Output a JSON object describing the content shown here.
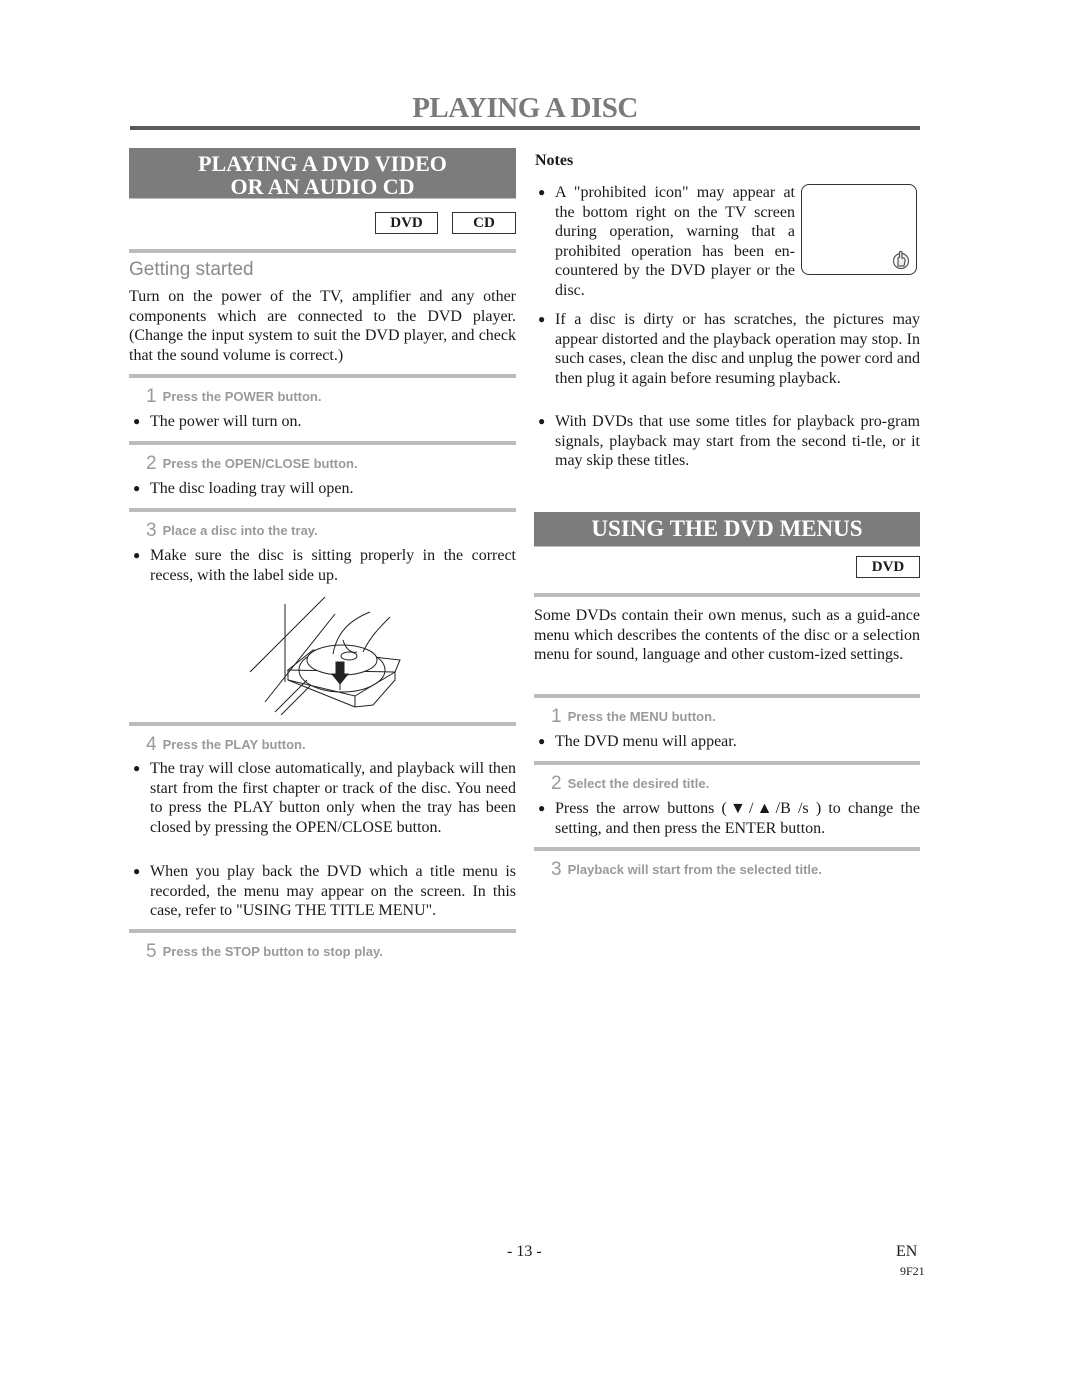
{
  "page": {
    "title": "PLAYING A DISC",
    "page_number": "- 13 -",
    "language": "EN",
    "model_code": "9F21"
  },
  "left_section": {
    "heading_line1": "PLAYING A DVD VIDEO",
    "heading_line2": "OR AN AUDIO CD",
    "badges": [
      "DVD",
      "CD"
    ],
    "subheading": "Getting started",
    "intro": "Turn on the power of the TV, amplifier and any other components which are connected to the DVD player. (Change the input system to suit the DVD player, and check that the sound volume is correct.)",
    "steps": [
      {
        "number": "1",
        "label": "Press the POWER button.",
        "bullets": [
          "The power will turn on."
        ]
      },
      {
        "number": "2",
        "label": "Press the OPEN/CLOSE button.",
        "bullets": [
          "The disc loading tray will open."
        ]
      },
      {
        "number": "3",
        "label": "Place a disc into the tray.",
        "bullets": [
          "Make sure the disc is sitting properly in the correct recess, with the label side up."
        ]
      },
      {
        "number": "4",
        "label": "Press the PLAY button.",
        "bullets": [
          "The tray will close automatically, and playback will then start from the first chapter or track of the disc. You need to press the PLAY button only when the tray has been closed by pressing the OPEN/CLOSE button.",
          "When you play back the DVD which a title menu is recorded, the menu may appear on the screen. In this case, refer to \"USING THE TITLE MENU\"."
        ]
      },
      {
        "number": "5",
        "label": "Press the STOP button to stop play.",
        "bullets": []
      }
    ],
    "illustration": "disc-tray-illustration"
  },
  "notes": {
    "label": "Notes",
    "items": [
      "A \"prohibited icon\" may appear at the bottom right on the TV screen during operation, warning that a prohibited operation has been en-countered by the DVD player or the disc.",
      "If a disc is dirty or has scratches, the pictures may appear distorted and the playback operation may stop. In such cases, clean the disc and unplug the power cord and then plug it again before resuming playback.",
      "With DVDs that use some titles for playback pro-gram signals, playback may start from the second ti-tle, or it may skip these titles."
    ],
    "tv_icon": "prohibited-hand-icon"
  },
  "right_section": {
    "heading": "USING THE DVD MENUS",
    "badges": [
      "DVD"
    ],
    "intro": "Some DVDs contain their own menus, such as a guid-ance menu which describes the contents of the disc or a selection menu for sound, language and other custom-ized settings.",
    "steps": [
      {
        "number": "1",
        "label": "Press the MENU button.",
        "bullets": [
          "The DVD menu will appear."
        ]
      },
      {
        "number": "2",
        "label": "Select the desired title.",
        "bullets": [
          "Press the arrow buttons (▼/▲/B /s  ) to change the setting, and then press the ENTER button."
        ]
      },
      {
        "number": "3",
        "label": "Playback will start from the selected title.",
        "bullets": []
      }
    ]
  }
}
